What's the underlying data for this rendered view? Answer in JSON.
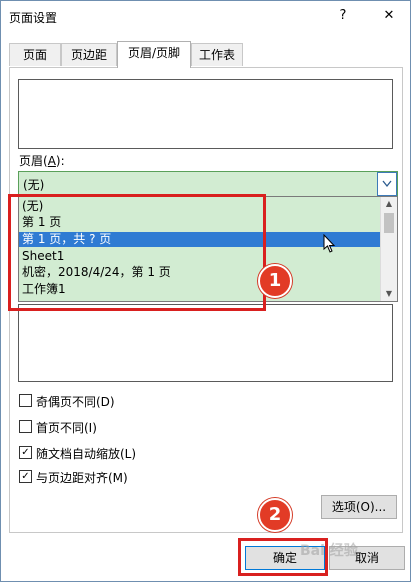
{
  "dialog": {
    "title": "页面设置",
    "help_label": "?",
    "close_label": "✕"
  },
  "tabs": [
    {
      "label": "页面"
    },
    {
      "label": "页边距"
    },
    {
      "label": "页眉/页脚"
    },
    {
      "label": "工作表"
    }
  ],
  "header_field": {
    "label_prefix": "页眉(",
    "label_key": "A",
    "label_suffix": "):",
    "selected_value": "(无)",
    "options": [
      "(无)",
      "第 1 页",
      "第 1 页，共 ? 页",
      "Sheet1",
      " 机密，2018/4/24，第 1 页",
      "工作簿1"
    ],
    "highlighted_index": 2
  },
  "checkboxes": [
    {
      "label": "奇偶页不同(D)",
      "checked": false
    },
    {
      "label": "首页不同(I)",
      "checked": false
    },
    {
      "label": "随文档自动缩放(L)",
      "checked": true
    },
    {
      "label": "与页边距对齐(M)",
      "checked": true
    }
  ],
  "buttons": {
    "options": "选项(O)...",
    "ok": "确定",
    "cancel": "取消"
  },
  "annotations": {
    "step1": "1",
    "step2": "2"
  },
  "watermark": "Bai 经验",
  "colors": {
    "highlight": "#2f7bd3",
    "dropdown_bg": "#d2ecd2",
    "annotation_red": "#d9201f"
  }
}
